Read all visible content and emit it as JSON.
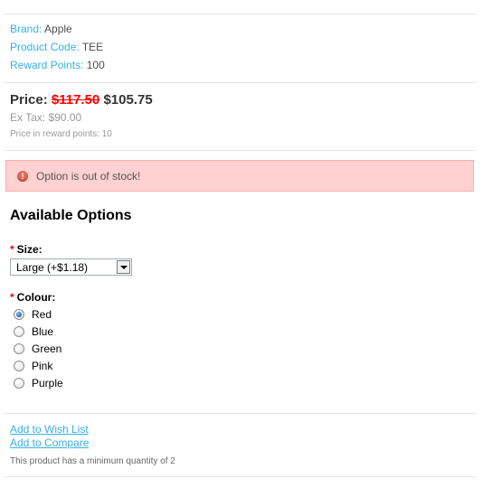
{
  "product": {
    "brand_label": "Brand:",
    "brand": "Apple",
    "code_label": "Product Code:",
    "code": "TEE",
    "reward_label": "Reward Points:",
    "reward": "100"
  },
  "price": {
    "label": "Price:",
    "old": "$117.50",
    "new": "$105.75",
    "ex_tax": "Ex Tax: $90.00",
    "reward_price": "Price in reward points: 10"
  },
  "alert": {
    "icon": "exclamation-icon",
    "icon_glyph": "!",
    "text": "Option is out of stock!",
    "color": "#ffd1d1"
  },
  "options": {
    "heading": "Available Options",
    "required_mark": "*",
    "size": {
      "label": "Size:",
      "selected": "Large (+$1.18)"
    },
    "colour": {
      "label": "Colour:",
      "items": [
        "Red",
        "Blue",
        "Green",
        "Pink",
        "Purple"
      ],
      "selected": "Red"
    }
  },
  "links": {
    "wishlist": "Add to Wish List",
    "compare": "Add to Compare"
  },
  "minimum": "This product has a minimum quantity of 2",
  "colors": {
    "link": "#38b0e3",
    "old_price": "#ff0000",
    "alert_bg": "#ffd1d1"
  }
}
